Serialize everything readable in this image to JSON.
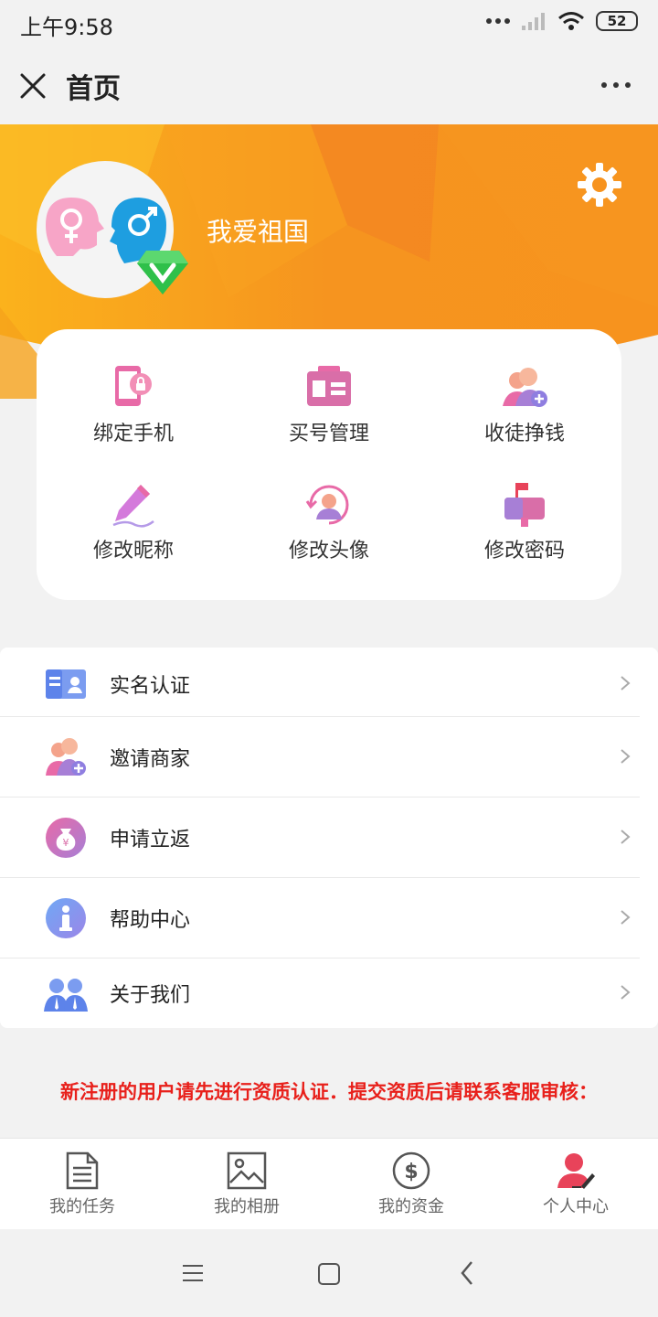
{
  "status_bar": {
    "time": "上午9:58",
    "battery": "52"
  },
  "title_bar": {
    "title": "首页"
  },
  "profile": {
    "nickname": "我爱祖国"
  },
  "quick_actions": [
    {
      "label": "绑定手机",
      "icon": "phone-lock-icon"
    },
    {
      "label": "买号管理",
      "icon": "id-card-icon"
    },
    {
      "label": "收徒挣钱",
      "icon": "add-people-icon"
    },
    {
      "label": "修改昵称",
      "icon": "pen-icon"
    },
    {
      "label": "修改头像",
      "icon": "avatar-refresh-icon"
    },
    {
      "label": "修改密码",
      "icon": "mailbox-icon"
    }
  ],
  "menu": [
    {
      "label": "实名认证",
      "icon": "id-card-icon"
    },
    {
      "label": "邀请商家",
      "icon": "invite-people-icon"
    },
    {
      "label": "申请立返",
      "icon": "money-bag-icon"
    },
    {
      "label": "帮助中心",
      "icon": "info-icon"
    },
    {
      "label": "关于我们",
      "icon": "team-icon"
    }
  ],
  "notice": "新注册的用户请先进行资质认证．提交资质后请联系客服审核：",
  "tabs": [
    {
      "label": "我的任务",
      "icon": "document-icon"
    },
    {
      "label": "我的相册",
      "icon": "image-icon"
    },
    {
      "label": "我的资金",
      "icon": "dollar-icon"
    },
    {
      "label": "个人中心",
      "icon": "user-edit-icon"
    }
  ],
  "colors": {
    "accent": "#f7931e",
    "notice": "#e8201b",
    "active_tab": "#e8435a"
  }
}
